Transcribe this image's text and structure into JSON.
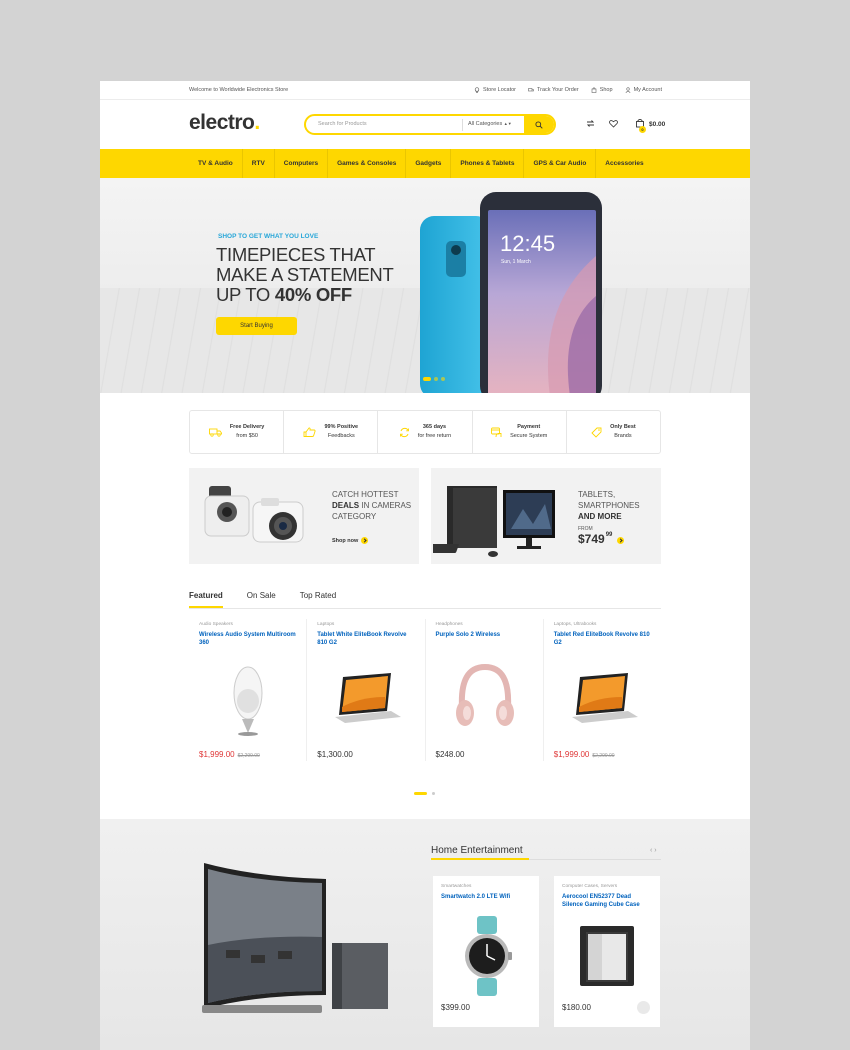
{
  "topbar": {
    "welcome": "Welcome to Worldwide Electronics Store",
    "links": [
      "Store Locator",
      "Track Your Order",
      "Shop",
      "My Account"
    ]
  },
  "header": {
    "logo": "electro",
    "logo_dot": ".",
    "search_placeholder": "Search for Products",
    "category": "All Categories",
    "cart_total": "$0.00",
    "cart_count": "0"
  },
  "nav": [
    "TV & Audio",
    "RTV",
    "Computers",
    "Games & Consoles",
    "Gadgets",
    "Phones & Tablets",
    "GPS & Car Audio",
    "Accessories"
  ],
  "hero": {
    "kicker": "SHOP TO GET WHAT YOU LOVE",
    "line1": "TIMEPIECES THAT",
    "line2": "MAKE A STATEMENT",
    "line3_prefix": "UP TO ",
    "line3_bold": "40% OFF",
    "cta": "Start Buying",
    "phone_time": "12:45",
    "phone_date": "Sun, 1 March"
  },
  "features": [
    {
      "title": "Free Delivery",
      "sub": "from $50",
      "icon": "truck-icon"
    },
    {
      "title": "99% Positive",
      "sub": "Feedbacks",
      "icon": "thumbs-up-icon"
    },
    {
      "title": "365 days",
      "sub": "for free return",
      "icon": "refresh-icon"
    },
    {
      "title": "Payment",
      "sub": "Secure System",
      "icon": "card-icon"
    },
    {
      "title": "Only Best",
      "sub": "Brands",
      "icon": "tag-icon"
    }
  ],
  "promos": {
    "p1_line1": "CATCH HOTTEST",
    "p1_bold": "DEALS",
    "p1_line2_rest": " IN CAMERAS",
    "p1_line3": "CATEGORY",
    "p1_link": "Shop now",
    "p2_line1": "TABLETS,",
    "p2_line2": "SMARTPHONES",
    "p2_bold": "AND MORE",
    "p2_from": "FROM",
    "p2_price": "$749",
    "p2_cents": "99"
  },
  "tabs": [
    "Featured",
    "On Sale",
    "Top Rated"
  ],
  "products": [
    {
      "cat": "Audio Speakers",
      "name": "Wireless Audio System Multiroom 360",
      "price": "$1,999.00",
      "old": "$2,299.00"
    },
    {
      "cat": "Laptops",
      "name": "Tablet White EliteBook Revolve 810 G2",
      "price": "$1,300.00",
      "old": ""
    },
    {
      "cat": "Headphones",
      "name": "Purple Solo 2 Wireless",
      "price": "$248.00",
      "old": ""
    },
    {
      "cat": "Laptops, Ultrabooks",
      "name": "Tablet Red EliteBook Revolve 810 G2",
      "price": "$1,999.00",
      "old": "$2,299.00"
    }
  ],
  "entertainment": {
    "title": "Home Entertainment",
    "arrows": "‹ ›",
    "cards": [
      {
        "cat": "Smartwatches",
        "name": "Smartwatch 2.0 LTE Wifi",
        "price": "$399.00"
      },
      {
        "cat": "Computer Cases, Servers",
        "name": "Aerocool EN52377 Dead Silence Gaming Cube Case",
        "price": "$180.00"
      }
    ]
  },
  "colors": {
    "accent": "#fed700",
    "link": "#0062bd",
    "sale": "#df3737",
    "kicker": "#27a6d8"
  }
}
